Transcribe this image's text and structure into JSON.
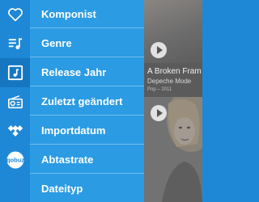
{
  "menu": {
    "items": [
      {
        "label": "Komponist"
      },
      {
        "label": "Genre"
      },
      {
        "label": "Release Jahr"
      },
      {
        "label": "Zuletzt geändert"
      },
      {
        "label": "Importdatum"
      },
      {
        "label": "Abtastrate"
      },
      {
        "label": "Dateityp"
      }
    ]
  },
  "rail": {
    "icons": [
      "heart-icon",
      "playlist-icon",
      "music-note-square-icon",
      "radio-icon",
      "tidal-icon",
      "qobuz-icon"
    ],
    "qobuz_label": "qobuz"
  },
  "content": {
    "album": {
      "title": "A Broken Fram",
      "artist": "Depeche Mode",
      "meta": "Pop – 2011"
    }
  },
  "colors": {
    "rail": "#1e88d6",
    "menu": "#2b9be3",
    "active": "#1676c0",
    "text": "#ffffff"
  }
}
